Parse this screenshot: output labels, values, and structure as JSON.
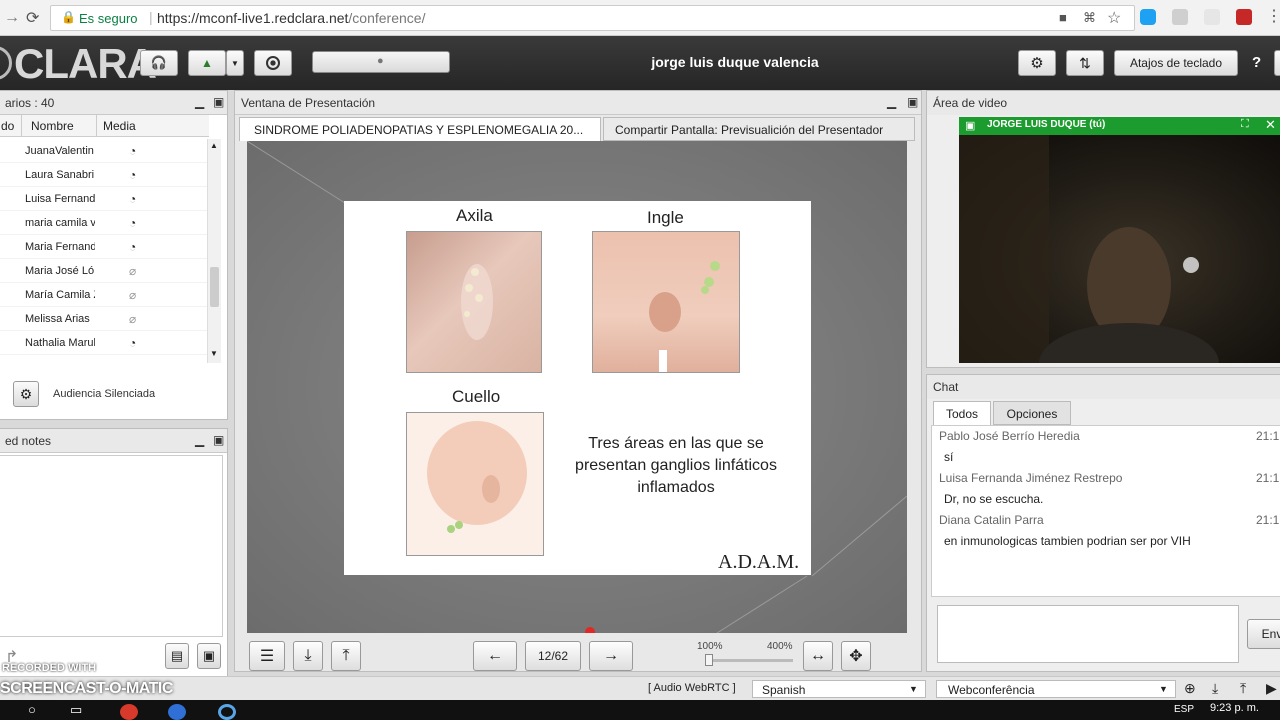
{
  "browser": {
    "secure_label": "Es seguro",
    "url_base": "https://mconf-live1.redclara.net",
    "url_path": "/conference/"
  },
  "toolbar": {
    "logo_text": "CLARA",
    "user_name": "jorge luis duque valencia",
    "shortcuts_label": "Atajos de teclado",
    "help_label": "?"
  },
  "users_panel": {
    "title": "arios : 40",
    "columns": [
      "do",
      "Nombre",
      "Media"
    ],
    "rows": [
      {
        "name": "JuanaValentin",
        "media": "ear"
      },
      {
        "name": "Laura Sanabri",
        "media": "ear"
      },
      {
        "name": "Luisa Fernand",
        "media": "ear"
      },
      {
        "name": "maria camila v",
        "media": "ear"
      },
      {
        "name": "Maria Fernand",
        "media": "ear"
      },
      {
        "name": "Maria José Ló",
        "media": "mic-muted"
      },
      {
        "name": "María Camila Z",
        "media": "mic-muted"
      },
      {
        "name": "Melissa Arias",
        "media": "mic-muted"
      },
      {
        "name": "Nathalia Marul",
        "media": "ear"
      }
    ],
    "audience_label": "Audiencia Silenciada"
  },
  "notes_panel": {
    "title": "ed notes"
  },
  "presentation": {
    "title": "Ventana de Presentación",
    "tab_active": "SINDROME POLIADENOPATIAS Y ESPLENOMEGALIA 20...",
    "tab_share": "Compartir Pantalla: Previsualición del Presentador",
    "slide": {
      "label_axila": "Axila",
      "label_ingle": "Ingle",
      "label_cuello": "Cuello",
      "caption": "Tres áreas en las que se presentan ganglios linfáticos inflamados",
      "brand": "A.D.A.M."
    },
    "page_indicator": "12/62",
    "zoom_min": "100%",
    "zoom_max": "400%"
  },
  "video": {
    "title": "Área de video",
    "caption": "JORGE LUIS DUQUE (tú)"
  },
  "chat": {
    "title": "Chat",
    "tab_all": "Todos",
    "tab_options": "Opciones",
    "messages": [
      {
        "name": "Pablo José Berrío Heredia",
        "time": "21:1",
        "text": "sí"
      },
      {
        "name": "Luisa Fernanda Jiménez Restrepo",
        "time": "21:1",
        "text": "Dr, no se escucha."
      },
      {
        "name": "Diana Catalin Parra",
        "time": "21:1",
        "text": "en inmunologicas tambien podrian ser por VIH"
      }
    ],
    "send_label": "Env"
  },
  "status_bar": {
    "audio": "[ Audio WebRTC ]",
    "language": "Spanish",
    "layout": "Webconferência",
    "watermark_top": "RECORDED WITH",
    "watermark_bottom": "SCREENCAST-O-MATIC"
  },
  "taskbar": {
    "lang": "ESP",
    "time": "9:23 p. m."
  },
  "colors": {
    "toolbar_bg": "#2e2e2e",
    "video_caption_bg": "#1c9b2e",
    "secure_green": "#0b8043"
  }
}
